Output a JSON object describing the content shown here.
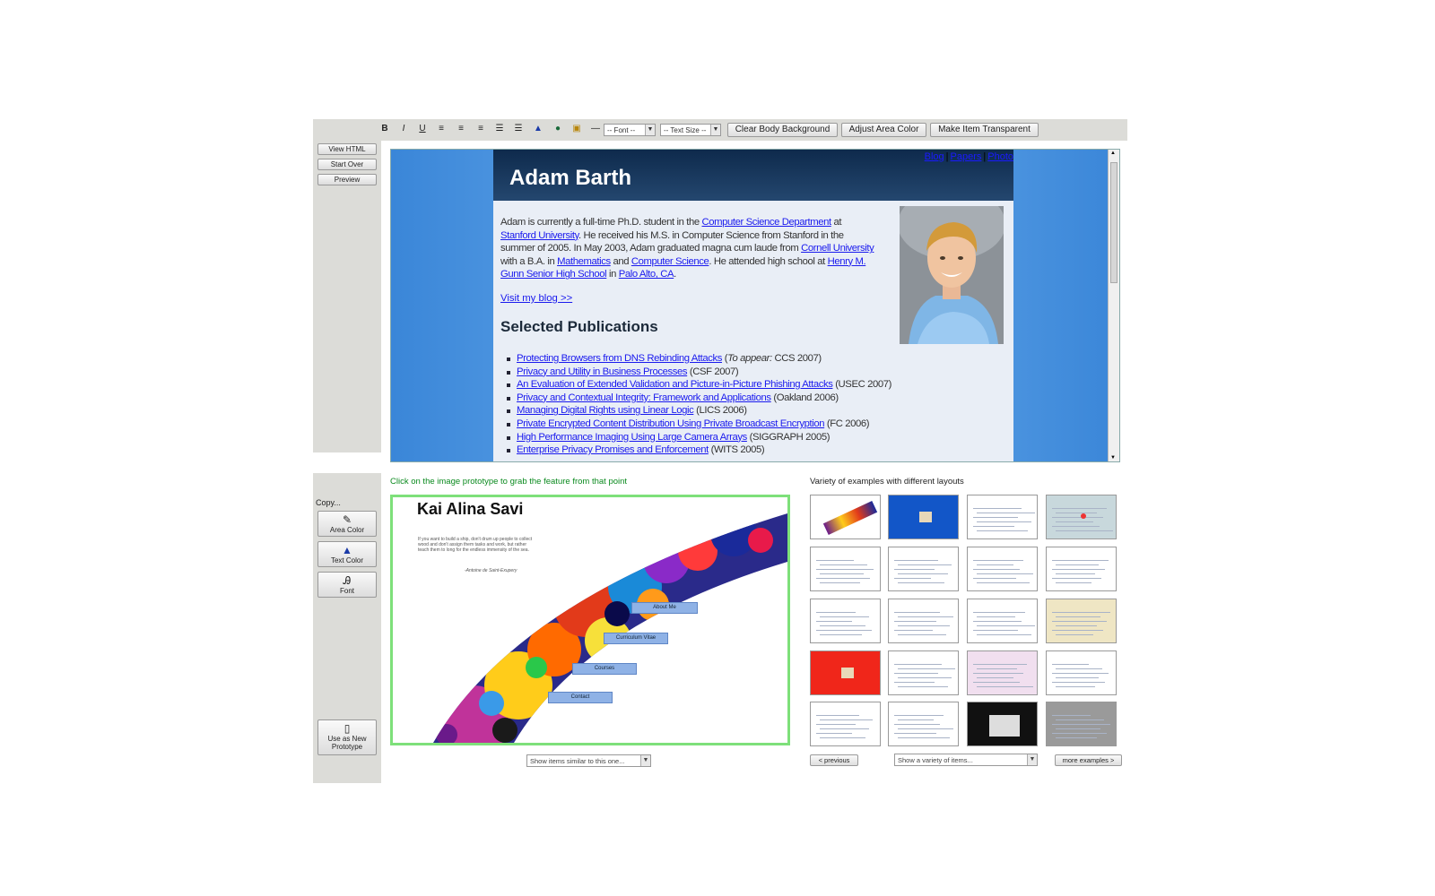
{
  "toolbar": {
    "bold_icon": "B",
    "italic_icon": "I",
    "underline_icon": "U",
    "font_select": "-- Font --",
    "text_size_select": "-- Text Size --",
    "clear_body_background": "Clear Body Background",
    "adjust_area_color": "Adjust Area Color",
    "make_item_transparent": "Make Item Transparent"
  },
  "side": {
    "view_html": "View HTML",
    "start_over": "Start Over",
    "preview": "Preview"
  },
  "preview_page": {
    "name": "Adam Barth",
    "nav": [
      "Blog",
      "Papers",
      "Photo"
    ],
    "nav_sep": "|",
    "bio": [
      {
        "t": "Adam is currently a full-time Ph.D. student in the "
      },
      {
        "t": "Computer Science Department",
        "link": true
      },
      {
        "t": " at "
      },
      {
        "t": "Stanford University",
        "link": true
      },
      {
        "t": ". He received his M.S. in Computer Science from Stanford in the summer of 2005. In May 2003, Adam graduated magna cum laude from "
      },
      {
        "t": "Cornell University",
        "link": true
      },
      {
        "t": " with a B.A. in "
      },
      {
        "t": "Mathematics",
        "link": true
      },
      {
        "t": " and "
      },
      {
        "t": "Computer Science",
        "link": true
      },
      {
        "t": ". He attended high school at "
      },
      {
        "t": "Henry M. Gunn Senior High School",
        "link": true
      },
      {
        "t": " in "
      },
      {
        "t": "Palo Alto, CA",
        "link": true
      },
      {
        "t": "."
      }
    ],
    "blog_link": "Visit my blog >>",
    "publications_heading": "Selected Publications",
    "publications": [
      {
        "title": "Protecting Browsers from DNS Rebinding Attacks",
        "venue_pre": "To appear:",
        "venue": " CCS 2007)"
      },
      {
        "title": "Privacy and Utility in Business Processes",
        "venue_pre": "",
        "venue": " (CSF 2007)"
      },
      {
        "title": "An Evaluation of Extended Validation and Picture-in-Picture Phishing Attacks",
        "venue_pre": "",
        "venue": " (USEC 2007)"
      },
      {
        "title": "Privacy and Contextual Integrity: Framework and Applications",
        "venue_pre": "",
        "venue": " (Oakland 2006)"
      },
      {
        "title": "Managing Digital Rights using Linear Logic",
        "venue_pre": "",
        "venue": " (LICS 2006)"
      },
      {
        "title": "Private Encrypted Content Distribution Using Private Broadcast Encryption",
        "venue_pre": "",
        "venue": " (FC 2006)"
      },
      {
        "title": "High Performance Imaging Using Large Camera Arrays",
        "venue_pre": "",
        "venue": " (SIGGRAPH 2005)"
      },
      {
        "title": "Enterprise Privacy Promises and Enforcement",
        "venue_pre": "",
        "venue": " (WITS 2005)"
      }
    ]
  },
  "copy_panel": {
    "label": "Copy...",
    "area_color": "Area Color",
    "text_color": "Text Color",
    "font": "Font",
    "use_as_new": "Use as New Prototype"
  },
  "prototype": {
    "instruction": "Click on the image prototype to grab the feature from that point",
    "title": "Kai Alina Savi",
    "quote": "If you want to build a ship, don't drum up people to collect wood and don't assign them tasks and work, but rather teach them to long for the endless immensity of the sea.",
    "author": "-Antoine de Saint-Exupery",
    "menu": [
      "About Me",
      "Curriculum Vitae",
      "Courses",
      "Contact"
    ],
    "similar_select": "Show items similar to this one..."
  },
  "examples": {
    "label": "Variety of examples with different layouts",
    "previous": "< previous",
    "variety_select": "Show a variety of items...",
    "more": "more examples >"
  },
  "colors": {
    "toolbar_bg": "#dcdcd8",
    "header_navy": "#13325a",
    "preview_blue": "#4a95e0",
    "green_text": "#0a8a1e",
    "selection_green": "#7ee07a"
  }
}
